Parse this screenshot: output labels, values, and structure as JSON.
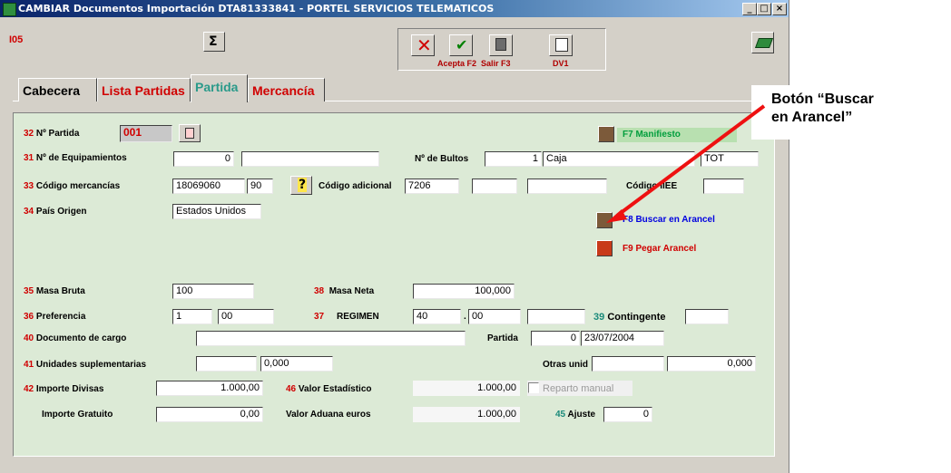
{
  "window": {
    "title": "CAMBIAR Documentos Importación  DTA81333841 - PORTEL SERVICIOS TELEMATICOS",
    "code": "I05",
    "controls": {
      "minimize": "_",
      "maximize": "□",
      "close": "×"
    }
  },
  "toolbar": {
    "acepta_label": "Acepta F2",
    "salir_label": "Salir F3",
    "dv1_label": "DV1"
  },
  "tabs": [
    "Cabecera",
    "Lista Partidas",
    "Partida",
    "Mercancía"
  ],
  "form": {
    "partida": {
      "num": "32",
      "label": "Nº Partida",
      "value": "001"
    },
    "equipamientos": {
      "num": "31",
      "label": "Nº de Equipamientos",
      "value": "0",
      "value2": ""
    },
    "bultos": {
      "label": "Nº de Bultos",
      "value": "1",
      "tipo": "Caja",
      "extra": "TOT"
    },
    "codigo": {
      "num": "33",
      "label": "Código mercancías",
      "value": "18069060",
      "sub": "90",
      "adicional_label": "Código adicional",
      "adicional": "7206",
      "field_a": "",
      "field_b": "",
      "iiee_label": "Código IIEE",
      "iiee": ""
    },
    "pais": {
      "num": "34",
      "label": "País Origen",
      "value": "Estados Unidos"
    },
    "manifiesto_label": "F7 Manifiesto",
    "buscar_label": "F8  Buscar en Arancel",
    "pegar_label": "F9 Pegar Arancel",
    "masa_bruta": {
      "num": "35",
      "label": "Masa Bruta",
      "value": "100"
    },
    "masa_neta": {
      "num": "38",
      "label": "Masa Neta",
      "value": "100,000"
    },
    "preferencia": {
      "num": "36",
      "label": "Preferencia",
      "value": "1",
      "value2": "00"
    },
    "regimen": {
      "num": "37",
      "label": "REGIMEN",
      "value": "40",
      "value2": "00",
      "value3": ""
    },
    "contingente": {
      "num": "39",
      "label": "Contingente",
      "value": ""
    },
    "documento": {
      "num": "40",
      "label": "Documento de cargo",
      "value": "",
      "partida_label": "Partida",
      "partida_value": "0",
      "fecha": "23/07/2004"
    },
    "unidades": {
      "num": "41",
      "label": "Unidades suplementarias",
      "value": "",
      "value2": "0,000",
      "otras_label": "Otras unid",
      "otras": "",
      "otras2": "0,000"
    },
    "importe_divisas": {
      "num": "42",
      "label": "Importe Divisas",
      "value": "1.000,00"
    },
    "valor_estadistico": {
      "num": "46",
      "label": "Valor Estadístico",
      "value": "1.000,00"
    },
    "reparto_label": "Reparto manual",
    "importe_gratuito": {
      "label": "Importe Gratuito",
      "value": "0,00"
    },
    "valor_aduana": {
      "label": "Valor Aduana euros",
      "value": "1.000,00"
    },
    "ajuste": {
      "num": "45",
      "label": "Ajuste",
      "value": "0"
    }
  },
  "annotation": {
    "line1": "Botón “Buscar",
    "line2": "en Arancel”"
  },
  "colors": {
    "titlebar": "#0a246a",
    "panel": "#dcead6",
    "label_number": "#d00000",
    "arrow": "#ee1111"
  }
}
